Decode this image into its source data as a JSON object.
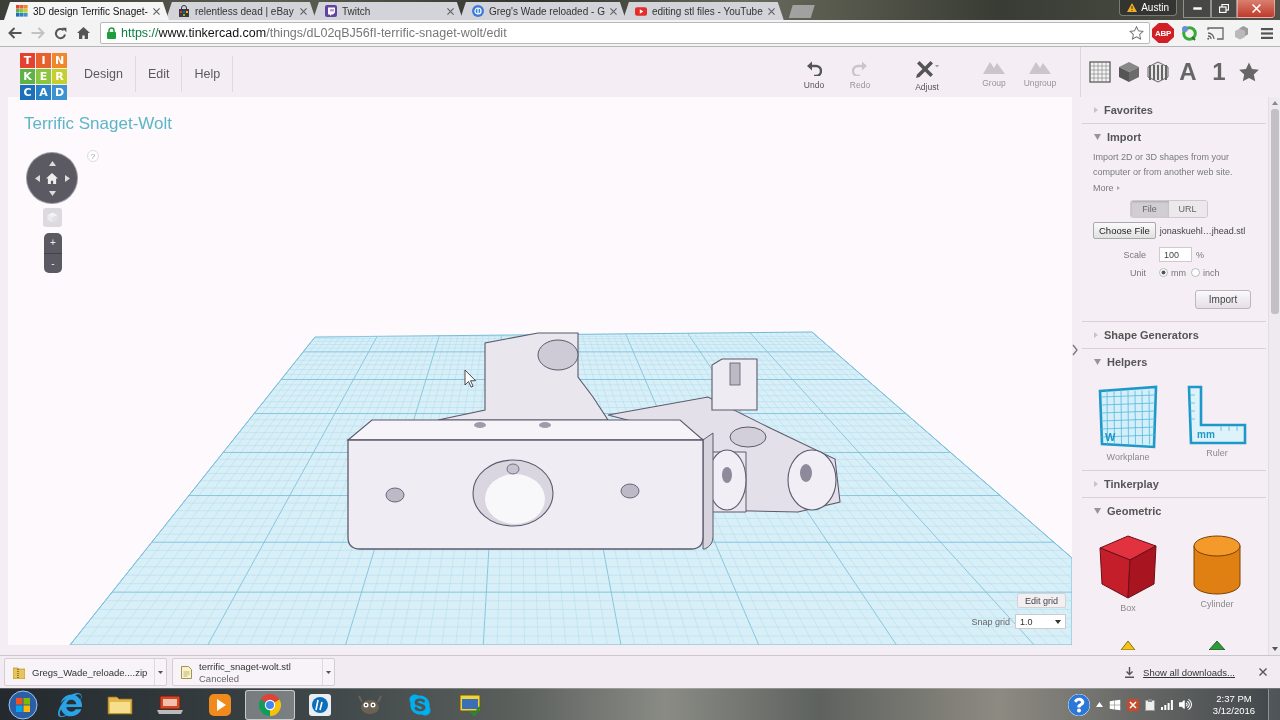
{
  "browser": {
    "tabs": [
      {
        "title": "3D design Terrific Snaget-",
        "kind": "tinkercad",
        "selected": true
      },
      {
        "title": "relentless dead | eBay",
        "kind": "ebay",
        "selected": false
      },
      {
        "title": "Twitch",
        "kind": "twitch",
        "selected": false
      },
      {
        "title": "Greg's Wade reloaded - G",
        "kind": "site",
        "selected": false
      },
      {
        "title": "editing stl files - YouTube",
        "kind": "youtube",
        "selected": false
      }
    ],
    "profile": "Austin",
    "nav": [
      {
        "kind": "back",
        "disabled": false
      },
      {
        "kind": "forward",
        "disabled": true
      },
      {
        "kind": "reload",
        "disabled": false
      },
      {
        "kind": "home",
        "disabled": false
      }
    ],
    "url": {
      "scheme": "https://",
      "host": "www.tinkercad.com",
      "path": "/things/dL02qBJ56fI-terrific-snaget-wolt/edit"
    },
    "adblock": "ABP"
  },
  "app": {
    "logo": [
      {
        "letter": "T",
        "color": "#e4412f"
      },
      {
        "letter": "I",
        "color": "#e8602c"
      },
      {
        "letter": "N",
        "color": "#f0872a"
      },
      {
        "letter": "K",
        "color": "#5fb246"
      },
      {
        "letter": "E",
        "color": "#8cc63f"
      },
      {
        "letter": "R",
        "color": "#c5cf30"
      },
      {
        "letter": "C",
        "color": "#1c6fb8"
      },
      {
        "letter": "A",
        "color": "#2a82c6"
      },
      {
        "letter": "D",
        "color": "#3c93cf"
      }
    ],
    "menu": [
      "Design",
      "Edit",
      "Help"
    ],
    "tools": [
      {
        "label": "Undo",
        "kind": "undo",
        "disabled": false
      },
      {
        "label": "Redo",
        "kind": "redo",
        "disabled": true
      },
      {
        "label": "Adjust",
        "kind": "adjust",
        "disabled": false
      },
      {
        "label": "Group",
        "kind": "group",
        "disabled": true
      },
      {
        "label": "Ungroup",
        "kind": "ungroup",
        "disabled": true
      }
    ],
    "shape_tools": [
      {
        "kind": "workplane"
      },
      {
        "kind": "solid"
      },
      {
        "kind": "hole"
      },
      {
        "kind": "text",
        "label": "A"
      },
      {
        "kind": "text",
        "label": "1"
      },
      {
        "kind": "favorite"
      }
    ]
  },
  "canvas": {
    "title": "Terrific Snaget-Wolt",
    "help": "?",
    "zoom_in": "+",
    "zoom_out": "-",
    "edit_grid": "Edit grid",
    "snap_grid": {
      "label": "Snap grid",
      "value": "1.0"
    }
  },
  "panel": {
    "sections": [
      {
        "title": "Favorites",
        "expanded": false
      },
      {
        "title": "Import",
        "expanded": true,
        "kind": "import",
        "text": "Import 2D or 3D shapes from your computer or from another web site.",
        "more": "More",
        "sources": [
          {
            "label": "File",
            "selected": true
          },
          {
            "label": "URL",
            "selected": false
          }
        ],
        "choose_file": "Choose File",
        "file_name": "jonaskuehl…jhead.stl",
        "scale": {
          "label": "Scale",
          "value": "100",
          "unit": "%"
        },
        "unit": {
          "label": "Unit",
          "options": [
            {
              "label": "mm",
              "selected": true
            },
            {
              "label": "inch",
              "selected": false
            }
          ]
        },
        "button": "Import"
      },
      {
        "title": "Shape Generators",
        "expanded": false
      },
      {
        "title": "Helpers",
        "expanded": true,
        "kind": "shapes",
        "items": [
          {
            "label": "Workplane",
            "kind": "workplane",
            "mark": "W"
          },
          {
            "label": "Ruler",
            "kind": "ruler",
            "mark": "mm"
          }
        ]
      },
      {
        "title": "Tinkerplay",
        "expanded": false
      },
      {
        "title": "Geometric",
        "expanded": true,
        "kind": "shapes",
        "items": [
          {
            "label": "Box",
            "kind": "box"
          },
          {
            "label": "Cylinder",
            "kind": "cylinder"
          },
          {
            "kind": "pyramid"
          },
          {
            "kind": "roof"
          }
        ]
      }
    ]
  },
  "downloads": {
    "items": [
      {
        "name": "Gregs_Wade_reloade....zip",
        "kind": "archive"
      },
      {
        "name": "terrific_snaget-wolt.stl",
        "kind": "document",
        "status": "Canceled"
      }
    ],
    "show_all": "Show all downloads..."
  },
  "taskbar": {
    "apps": [
      {
        "kind": "ie",
        "selected": false
      },
      {
        "kind": "explorer",
        "selected": false
      },
      {
        "kind": "slides",
        "selected": false
      },
      {
        "kind": "media",
        "selected": false
      },
      {
        "kind": "chrome",
        "selected": true
      },
      {
        "kind": "hp",
        "selected": false
      },
      {
        "kind": "gimp",
        "selected": false
      },
      {
        "kind": "skype",
        "selected": false
      },
      {
        "kind": "tool",
        "selected": false
      }
    ],
    "time": "2:37 PM",
    "date": "3/12/2016"
  }
}
